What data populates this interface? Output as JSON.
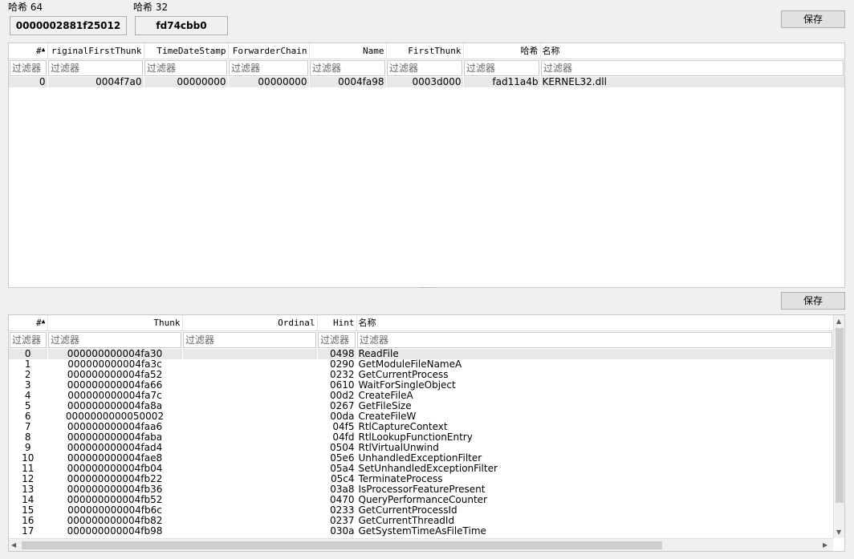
{
  "hash64": {
    "label": "哈希 64",
    "value": "0000002881f25012"
  },
  "hash32": {
    "label": "哈希 32",
    "value": "fd74cbb0"
  },
  "save_label": "保存",
  "filter_placeholder": "过滤器",
  "imports": {
    "columns": [
      "#",
      "riginalFirstThunk",
      "TimeDateStamp",
      "ForwarderChain",
      "Name",
      "FirstThunk",
      "哈希",
      "名称"
    ],
    "rows": [
      {
        "idx": "0",
        "oft": "0004f7a0",
        "tds": "00000000",
        "fc": "00000000",
        "name_rva": "0004fa98",
        "ft": "0003d000",
        "hash": "fad11a4b",
        "name": "KERNEL32.dll"
      }
    ]
  },
  "functions": {
    "columns": [
      "#",
      "Thunk",
      "Ordinal",
      "Hint",
      "名称"
    ],
    "rows": [
      {
        "idx": "0",
        "thunk": "000000000004fa30",
        "ordinal": "",
        "hint": "0498",
        "name": "ReadFile"
      },
      {
        "idx": "1",
        "thunk": "000000000004fa3c",
        "ordinal": "",
        "hint": "0290",
        "name": "GetModuleFileNameA"
      },
      {
        "idx": "2",
        "thunk": "000000000004fa52",
        "ordinal": "",
        "hint": "0232",
        "name": "GetCurrentProcess"
      },
      {
        "idx": "3",
        "thunk": "000000000004fa66",
        "ordinal": "",
        "hint": "0610",
        "name": "WaitForSingleObject"
      },
      {
        "idx": "4",
        "thunk": "000000000004fa7c",
        "ordinal": "",
        "hint": "00d2",
        "name": "CreateFileA"
      },
      {
        "idx": "5",
        "thunk": "000000000004fa8a",
        "ordinal": "",
        "hint": "0267",
        "name": "GetFileSize"
      },
      {
        "idx": "6",
        "thunk": "0000000000050002",
        "ordinal": "",
        "hint": "00da",
        "name": "CreateFileW"
      },
      {
        "idx": "7",
        "thunk": "000000000004faa6",
        "ordinal": "",
        "hint": "04f5",
        "name": "RtlCaptureContext"
      },
      {
        "idx": "8",
        "thunk": "000000000004faba",
        "ordinal": "",
        "hint": "04fd",
        "name": "RtlLookupFunctionEntry"
      },
      {
        "idx": "9",
        "thunk": "000000000004fad4",
        "ordinal": "",
        "hint": "0504",
        "name": "RtlVirtualUnwind"
      },
      {
        "idx": "10",
        "thunk": "000000000004fae8",
        "ordinal": "",
        "hint": "05e6",
        "name": "UnhandledExceptionFilter"
      },
      {
        "idx": "11",
        "thunk": "000000000004fb04",
        "ordinal": "",
        "hint": "05a4",
        "name": "SetUnhandledExceptionFilter"
      },
      {
        "idx": "12",
        "thunk": "000000000004fb22",
        "ordinal": "",
        "hint": "05c4",
        "name": "TerminateProcess"
      },
      {
        "idx": "13",
        "thunk": "000000000004fb36",
        "ordinal": "",
        "hint": "03a8",
        "name": "IsProcessorFeaturePresent"
      },
      {
        "idx": "14",
        "thunk": "000000000004fb52",
        "ordinal": "",
        "hint": "0470",
        "name": "QueryPerformanceCounter"
      },
      {
        "idx": "15",
        "thunk": "000000000004fb6c",
        "ordinal": "",
        "hint": "0233",
        "name": "GetCurrentProcessId"
      },
      {
        "idx": "16",
        "thunk": "000000000004fb82",
        "ordinal": "",
        "hint": "0237",
        "name": "GetCurrentThreadId"
      },
      {
        "idx": "17",
        "thunk": "000000000004fb98",
        "ordinal": "",
        "hint": "030a",
        "name": "GetSystemTimeAsFileTime"
      }
    ]
  }
}
